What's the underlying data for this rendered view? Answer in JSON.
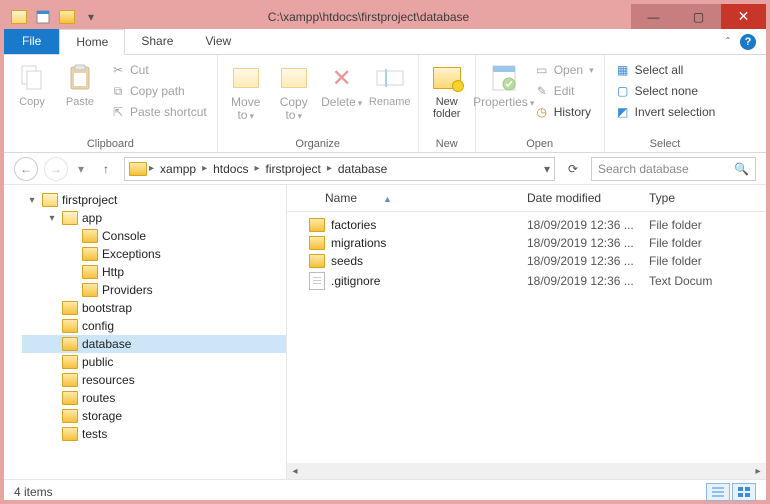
{
  "title": "C:\\xampp\\htdocs\\firstproject\\database",
  "tabs": {
    "file": "File",
    "home": "Home",
    "share": "Share",
    "view": "View"
  },
  "ribbon": {
    "clipboard": {
      "label": "Clipboard",
      "copy": "Copy",
      "paste": "Paste",
      "cut": "Cut",
      "copypath": "Copy path",
      "pasteshort": "Paste shortcut"
    },
    "organize": {
      "label": "Organize",
      "moveto": "Move to",
      "copyto": "Copy to",
      "delete": "Delete",
      "rename": "Rename"
    },
    "new": {
      "label": "New",
      "newfolder": "New folder"
    },
    "open": {
      "label": "Open",
      "properties": "Properties",
      "open": "Open",
      "edit": "Edit",
      "history": "History"
    },
    "select": {
      "label": "Select",
      "selectall": "Select all",
      "selectnone": "Select none",
      "invert": "Invert selection"
    }
  },
  "breadcrumb": [
    "xampp",
    "htdocs",
    "firstproject",
    "database"
  ],
  "search_placeholder": "Search database",
  "tree": [
    {
      "name": "firstproject",
      "depth": 0,
      "open": true,
      "caret": "▾"
    },
    {
      "name": "app",
      "depth": 1,
      "open": true,
      "caret": "▾"
    },
    {
      "name": "Console",
      "depth": 2
    },
    {
      "name": "Exceptions",
      "depth": 2
    },
    {
      "name": "Http",
      "depth": 2
    },
    {
      "name": "Providers",
      "depth": 2
    },
    {
      "name": "bootstrap",
      "depth": 1
    },
    {
      "name": "config",
      "depth": 1
    },
    {
      "name": "database",
      "depth": 1,
      "sel": true
    },
    {
      "name": "public",
      "depth": 1
    },
    {
      "name": "resources",
      "depth": 1
    },
    {
      "name": "routes",
      "depth": 1
    },
    {
      "name": "storage",
      "depth": 1
    },
    {
      "name": "tests",
      "depth": 1
    }
  ],
  "columns": {
    "name": "Name",
    "date": "Date modified",
    "type": "Type"
  },
  "rows": [
    {
      "name": "factories",
      "date": "18/09/2019 12:36 ...",
      "type": "File folder",
      "kind": "folder"
    },
    {
      "name": "migrations",
      "date": "18/09/2019 12:36 ...",
      "type": "File folder",
      "kind": "folder"
    },
    {
      "name": "seeds",
      "date": "18/09/2019 12:36 ...",
      "type": "File folder",
      "kind": "folder"
    },
    {
      "name": ".gitignore",
      "date": "18/09/2019 12:36 ...",
      "type": "Text Docum",
      "kind": "file"
    }
  ],
  "status": "4 items"
}
